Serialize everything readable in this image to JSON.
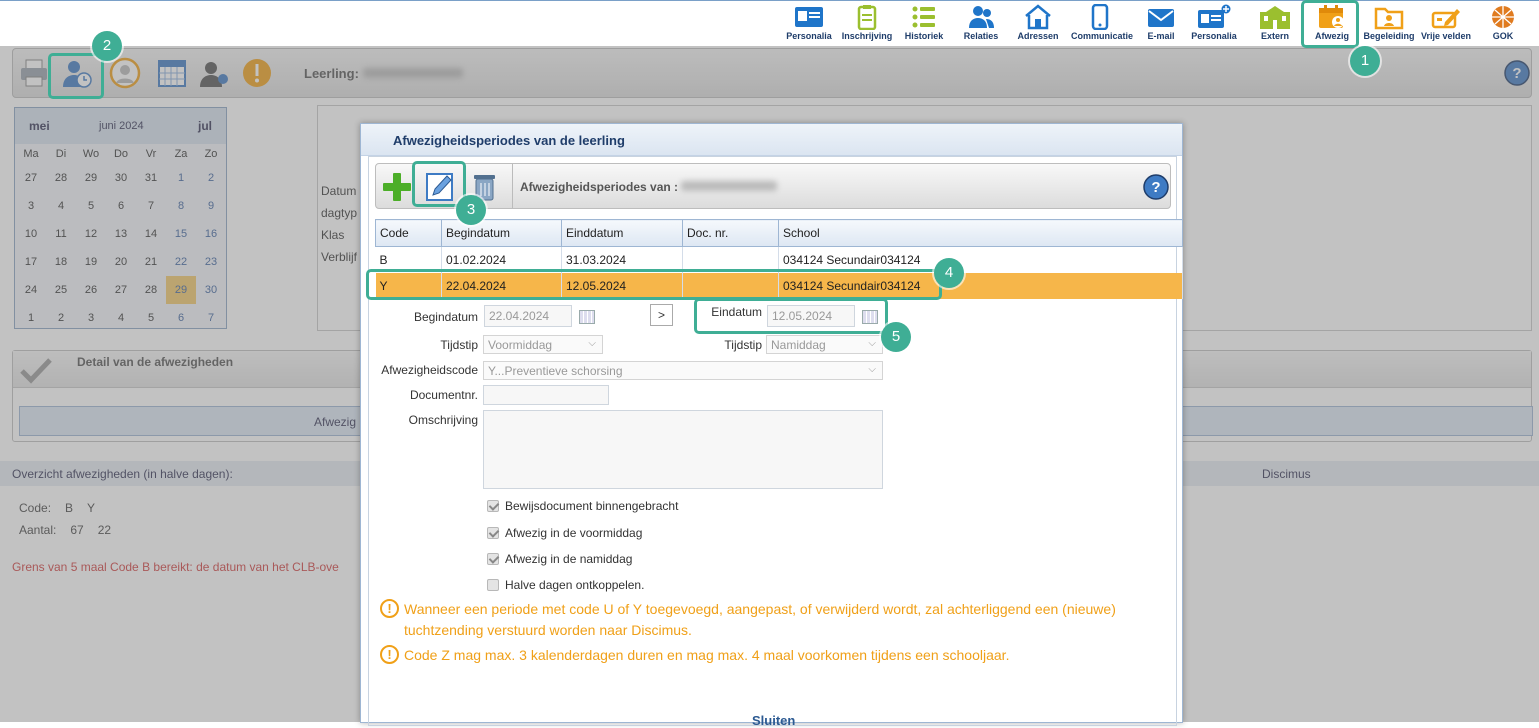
{
  "nav": {
    "items": [
      {
        "label": "Personalia",
        "icon": "id-card-icon",
        "color": "#1f75c9"
      },
      {
        "label": "Inschrijving",
        "icon": "clipboard-icon",
        "color": "#9bbf2f"
      },
      {
        "label": "Historiek",
        "icon": "list-icon",
        "color": "#9bbf2f"
      },
      {
        "label": "Relaties",
        "icon": "people-icon",
        "color": "#1f75c9"
      },
      {
        "label": "Adressen",
        "icon": "house-icon",
        "color": "#1f75c9"
      },
      {
        "label": "Communicatie",
        "icon": "phone-icon",
        "color": "#1f75c9"
      },
      {
        "label": "E-mail",
        "icon": "envelope-icon",
        "color": "#1f75c9"
      },
      {
        "label": "Personalia",
        "icon": "id-card-plus-icon",
        "color": "#1f75c9"
      },
      {
        "label": "Extern",
        "icon": "building-icon",
        "color": "#9bbf2f"
      },
      {
        "label": "Afwezig",
        "icon": "calendar-person-icon",
        "color": "#f0a018"
      },
      {
        "label": "Begeleiding",
        "icon": "folder-person-icon",
        "color": "#f0a018"
      },
      {
        "label": "Vrije velden",
        "icon": "pencil-form-icon",
        "color": "#f0a018"
      },
      {
        "label": "GOK",
        "icon": "globe-icon",
        "color": "#e07b1f"
      }
    ]
  },
  "student_bar": {
    "label": "Leerling:"
  },
  "calendar": {
    "prev": "mei",
    "current": "juni 2024",
    "next": "jul",
    "weekdays": [
      "Ma",
      "Di",
      "Wo",
      "Do",
      "Vr",
      "Za",
      "Zo"
    ],
    "days": [
      "27",
      "28",
      "29",
      "30",
      "31",
      "1",
      "2",
      "3",
      "4",
      "5",
      "6",
      "7",
      "8",
      "9",
      "10",
      "11",
      "12",
      "13",
      "14",
      "15",
      "16",
      "17",
      "18",
      "19",
      "20",
      "21",
      "22",
      "23",
      "24",
      "25",
      "26",
      "27",
      "28",
      "29",
      "30",
      "1",
      "2",
      "3",
      "4",
      "5",
      "6",
      "7"
    ],
    "selected_day": "30"
  },
  "info": {
    "lines": [
      "Datum",
      "dagtyp",
      "Klas",
      "Verblijf"
    ]
  },
  "detail": {
    "title": "Detail van de afwezigheden",
    "bar_text": "Afwezig"
  },
  "overzicht": {
    "title": "Overzicht afwezigheden (in halve dagen):",
    "discimus": "Discimus",
    "code_label": "Code:",
    "codes": [
      "B",
      "Y"
    ],
    "count_label": "Aantal:",
    "counts": [
      "67",
      "22"
    ],
    "warning": "Grens van 5 maal Code B bereikt: de datum van het CLB-ove"
  },
  "modal": {
    "title": "Afwezigheidsperiodes van de leerling",
    "toolbar_title": "Afwezigheidsperiodes van :",
    "columns": [
      "Code",
      "Begindatum",
      "Einddatum",
      "Doc. nr.",
      "School"
    ],
    "rows": [
      {
        "code": "B",
        "begin": "01.02.2024",
        "end": "31.03.2024",
        "doc": "",
        "school": "034124 Secundair034124"
      },
      {
        "code": "Y",
        "begin": "22.04.2024",
        "end": "12.05.2024",
        "doc": "",
        "school": "034124 Secundair034124"
      }
    ],
    "form": {
      "begin_label": "Begindatum",
      "begin_value": "22.04.2024",
      "arrow": ">",
      "end_label": "Eindatum",
      "end_value": "12.05.2024",
      "time_label": "Tijdstip",
      "time_begin": "Voormiddag",
      "time_end_label": "Tijdstip",
      "time_end": "Namiddag",
      "code_label": "Afwezigheidscode",
      "code_value": "Y...Preventieve schorsing",
      "doc_label": "Documentnr.",
      "doc_value": "",
      "desc_label": "Omschrijving",
      "desc_value": ""
    },
    "checkboxes": [
      {
        "label": "Bewijsdocument binnengebracht",
        "checked": true
      },
      {
        "label": "Afwezig in de voormiddag",
        "checked": true
      },
      {
        "label": "Afwezig in de namiddag",
        "checked": true
      },
      {
        "label": "Halve dagen ontkoppelen.",
        "checked": false
      }
    ],
    "warnings": [
      "Wanneer een periode met code U of Y toegevoegd, aangepast, of verwijderd wordt, zal achterliggend een (nieuwe) tuchtzending verstuurd worden naar Discimus.",
      "Code Z mag max. 3 kalenderdagen duren en mag max. 4 maal voorkomen tijdens een schooljaar."
    ],
    "close_label": "Sluiten"
  },
  "annotations": [
    "1",
    "2",
    "3",
    "4",
    "5"
  ],
  "colors": {
    "accent": "#3fae95",
    "selected_row": "#f6b64a",
    "warning": "#f0a018",
    "error": "#d24141",
    "nav_text": "#1f3d6a"
  }
}
